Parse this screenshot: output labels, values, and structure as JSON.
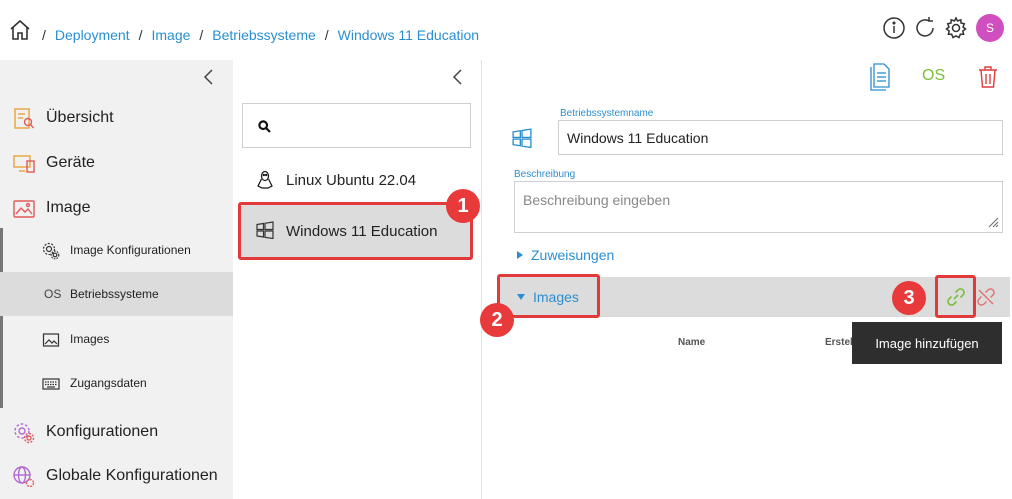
{
  "breadcrumb": {
    "separator": "/",
    "items": [
      "Deployment",
      "Image",
      "Betriebssysteme",
      "Windows 11 Education"
    ]
  },
  "user": {
    "initial": "S",
    "avatar_color": "#d04fc0"
  },
  "sidebar": {
    "items": [
      {
        "label": "Übersicht"
      },
      {
        "label": "Geräte"
      },
      {
        "label": "Image"
      },
      {
        "label": "Image Konfigurationen"
      },
      {
        "label": "Betriebssysteme",
        "prefix": "OS"
      },
      {
        "label": "Images"
      },
      {
        "label": "Zugangsdaten"
      },
      {
        "label": "Konfigurationen"
      },
      {
        "label": "Globale Konfigurationen"
      }
    ]
  },
  "toolbar": {
    "os_label": "OS"
  },
  "os_list": [
    {
      "label": "Linux Ubuntu 22.04"
    },
    {
      "label": "Windows 11 Education"
    }
  ],
  "detail": {
    "name_label": "Betriebssystemname",
    "name_value": "Windows 11 Education",
    "desc_label": "Beschreibung",
    "desc_placeholder": "Beschreibung eingeben",
    "assignments_label": "Zuweisungen",
    "images_label": "Images",
    "col_name": "Name",
    "col_created": "Erstelldatum",
    "tooltip": "Image hinzufügen"
  },
  "annotations": {
    "badge1": "1",
    "badge2": "2",
    "badge3": "3"
  },
  "colors": {
    "accent": "#2a8fd0",
    "link_green": "#7bbf3c",
    "danger": "#e03a3a"
  }
}
